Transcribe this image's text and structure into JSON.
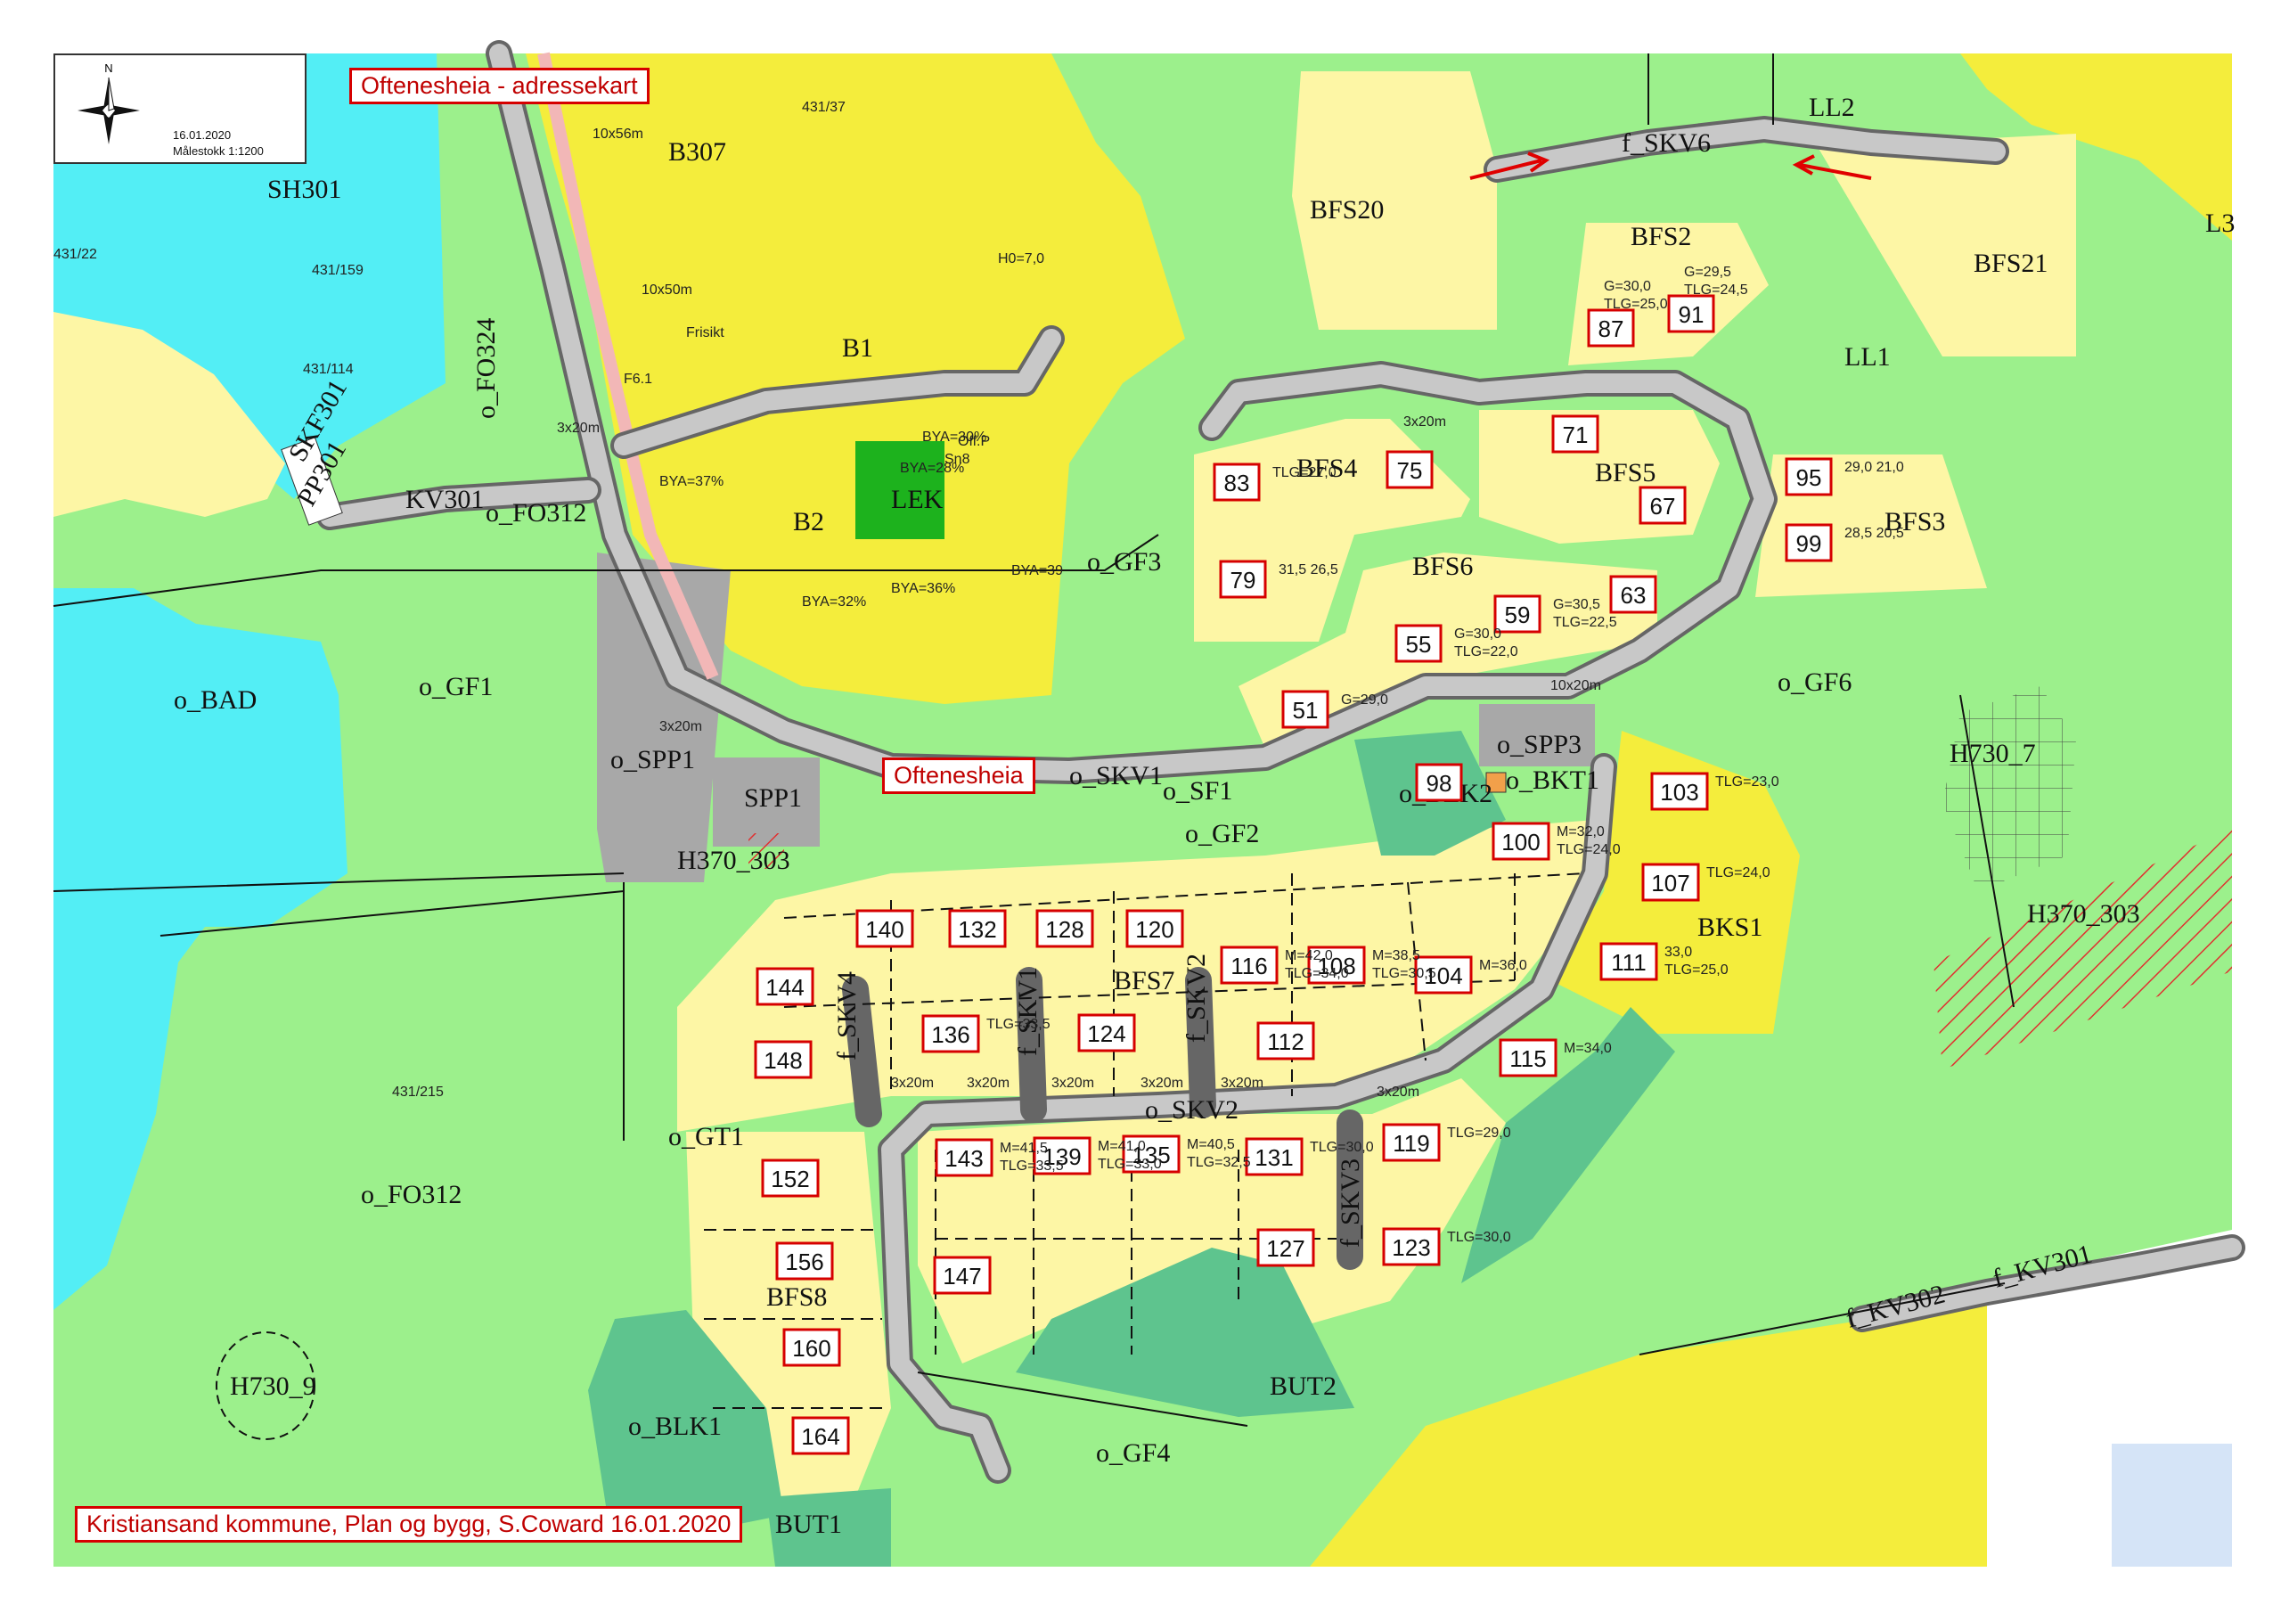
{
  "title": "Oftenesheia  - adressekart",
  "north_box": {
    "arrow_label": "N",
    "date": "16.01.2020",
    "scale": "Målestokk 1:1200"
  },
  "footer": "Kristiansand kommune, Plan og bygg, S.Coward 16.01.2020",
  "road_label": "Oftenesheia",
  "colors": {
    "residential": "#fdf6a5",
    "built_yellow": "#f4ed3c",
    "green": "#9cf08c",
    "dark_green": "#5ec48e",
    "water": "#53eef5",
    "road": "#c8c8c8",
    "road_edge": "#666666",
    "label_red": "#d60000",
    "play_green": "#1db21d"
  },
  "zones": [
    {
      "id": "SH301",
      "label": "SH301"
    },
    {
      "id": "B307",
      "label": "B307"
    },
    {
      "id": "o_FO324",
      "label": "o_FO324"
    },
    {
      "id": "BFS20",
      "label": "BFS20"
    },
    {
      "id": "LL2",
      "label": "LL2"
    },
    {
      "id": "SKV6",
      "label": "f_SKV6"
    },
    {
      "id": "BFS21",
      "label": "BFS21"
    },
    {
      "id": "LL1",
      "label": "LL1"
    },
    {
      "id": "L3",
      "label": "L3"
    },
    {
      "id": "BFS2",
      "label": "BFS2"
    },
    {
      "id": "BFS4",
      "label": "BFS4"
    },
    {
      "id": "BFS5",
      "label": "BFS5"
    },
    {
      "id": "BFS3",
      "label": "BFS3"
    },
    {
      "id": "BFS6",
      "label": "BFS6"
    },
    {
      "id": "o_GF3",
      "label": "o_GF3"
    },
    {
      "id": "o_GF1",
      "label": "o_GF1"
    },
    {
      "id": "o_BAD",
      "label": "o_BAD"
    },
    {
      "id": "o_SPP1",
      "label": "o_SPP1"
    },
    {
      "id": "SPP1",
      "label": "SPP1"
    },
    {
      "id": "o_SKV1",
      "label": "o_SKV1"
    },
    {
      "id": "o_SF1",
      "label": "o_SF1"
    },
    {
      "id": "o_GF2",
      "label": "o_GF2"
    },
    {
      "id": "o_SPP3",
      "label": "o_SPP3"
    },
    {
      "id": "o_BKT1",
      "label": "o_BKT1"
    },
    {
      "id": "o_BEK2",
      "label": "o_BEK2"
    },
    {
      "id": "o_GF6",
      "label": "o_GF6"
    },
    {
      "id": "H730_7",
      "label": "H730_7"
    },
    {
      "id": "H370_303a",
      "label": "H370_303"
    },
    {
      "id": "H370_303b",
      "label": "H370_303"
    },
    {
      "id": "BKS1",
      "label": "BKS1"
    },
    {
      "id": "BFS7",
      "label": "BFS7"
    },
    {
      "id": "o_SKV2",
      "label": "o_SKV2"
    },
    {
      "id": "f_SKV4",
      "label": "f_SKV4"
    },
    {
      "id": "f_SKV1",
      "label": "f_SKV1"
    },
    {
      "id": "f_SKV2",
      "label": "f_SKV2"
    },
    {
      "id": "f_SKV3",
      "label": "f_SKV3"
    },
    {
      "id": "o_GT1",
      "label": "o_GT1"
    },
    {
      "id": "o_FO312",
      "label": "o_FO312"
    },
    {
      "id": "o_FO312b",
      "label": "o_FO312"
    },
    {
      "id": "BFS8",
      "label": "BFS8"
    },
    {
      "id": "o_BLK1",
      "label": "o_BLK1"
    },
    {
      "id": "BUT1",
      "label": "BUT1"
    },
    {
      "id": "BUT2",
      "label": "BUT2"
    },
    {
      "id": "o_GF4",
      "label": "o_GF4"
    },
    {
      "id": "H730_9",
      "label": "H730_9"
    },
    {
      "id": "f_KV301",
      "label": "f_KV301"
    },
    {
      "id": "f_KV302",
      "label": "f_KV302"
    },
    {
      "id": "KV301",
      "label": "KV301"
    },
    {
      "id": "SKF301",
      "label": "SKF301"
    },
    {
      "id": "PP301",
      "label": "PP301"
    },
    {
      "id": "LEK",
      "label": "LEK"
    },
    {
      "id": "B1",
      "label": "B1"
    },
    {
      "id": "B2",
      "label": "B2"
    }
  ],
  "plots": [
    "87",
    "91",
    "71",
    "75",
    "83",
    "67",
    "95",
    "99",
    "79",
    "63",
    "59",
    "55",
    "51",
    "98",
    "103",
    "100",
    "107",
    "111",
    "140",
    "132",
    "128",
    "120",
    "116",
    "108",
    "104",
    "144",
    "136",
    "124",
    "112",
    "115",
    "148",
    "143",
    "139",
    "135",
    "131",
    "119",
    "152",
    "156",
    "147",
    "127",
    "123",
    "160",
    "164"
  ],
  "plot_values": [
    {
      "plot": "87",
      "text": "G=30,0 TLG=25,0"
    },
    {
      "plot": "91",
      "text": "G=29,5 TLG=24,5"
    },
    {
      "plot": "83",
      "text": "TLG=27,0"
    },
    {
      "plot": "79",
      "text": "31,5 26,5"
    },
    {
      "plot": "95",
      "text": "29,0 21,0"
    },
    {
      "plot": "99",
      "text": "28,5 20,5"
    },
    {
      "plot": "59",
      "text": "G=30,5 TLG=22,5"
    },
    {
      "plot": "55",
      "text": "G=30,0 TLG=22,0"
    },
    {
      "plot": "51",
      "text": "G=29,0"
    },
    {
      "plot": "103",
      "text": "TLG=23,0"
    },
    {
      "plot": "100",
      "text": "M=32,0 TLG=24,0"
    },
    {
      "plot": "107",
      "text": "TLG=24,0"
    },
    {
      "plot": "111",
      "text": "33,0 TLG=25,0"
    },
    {
      "plot": "116",
      "text": "M=42,0 TLG=34,0"
    },
    {
      "plot": "108",
      "text": "M=38,5 TLG=30,5"
    },
    {
      "plot": "104",
      "text": "M=36,0"
    },
    {
      "plot": "136",
      "text": "TLG=33,5"
    },
    {
      "plot": "115",
      "text": "M=34,0"
    },
    {
      "plot": "143",
      "text": "M=41,5 TLG=33,5"
    },
    {
      "plot": "139",
      "text": "M=41,0 TLG=33,0"
    },
    {
      "plot": "135",
      "text": "M=40,5 TLG=32,5"
    },
    {
      "plot": "131",
      "text": "TLG=30,0"
    },
    {
      "plot": "119",
      "text": "TLG=29,0"
    },
    {
      "plot": "123",
      "text": "TLG=30,0"
    }
  ],
  "road_widths": [
    "3x20m",
    "10x20m",
    "3x20m",
    "3x20m",
    "3x20m",
    "3x20m",
    "3x20m",
    "3x20m",
    "3x20m",
    "3x20m"
  ],
  "misc_text": [
    "431/37",
    "431/159",
    "431/22",
    "431/114",
    "431/215",
    "10x56m",
    "10x50m",
    "Frisikt",
    "H0=7,0",
    "BYA=37%",
    "BYA=36%",
    "BYA=39",
    "BYA=32%",
    "BYA=28%",
    "BYA=30%",
    "Off.P",
    "Sn8",
    "F6.1"
  ]
}
